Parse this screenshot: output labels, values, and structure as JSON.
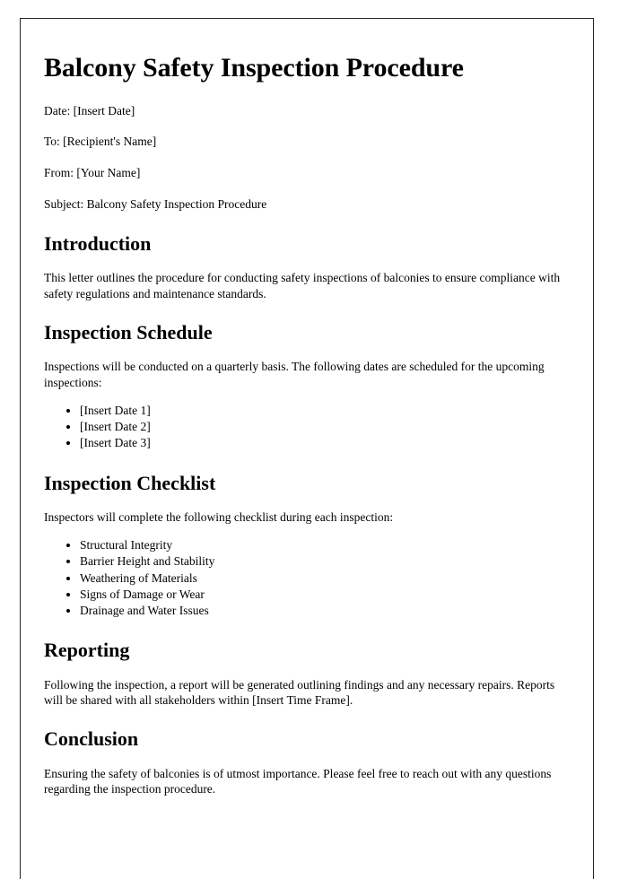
{
  "document": {
    "title": "Balcony Safety Inspection Procedure",
    "meta": [
      {
        "label": "Date:",
        "value": "[Insert Date]",
        "full": "Date: [Insert Date]"
      },
      {
        "label": "To:",
        "value": "[Recipient's Name]",
        "full": "To: [Recipient's Name]"
      },
      {
        "label": "From:",
        "value": "[Your Name]",
        "full": "From: [Your Name]"
      },
      {
        "label": "Subject:",
        "value": "Balcony Safety Inspection Procedure",
        "full": "Subject: Balcony Safety Inspection Procedure"
      }
    ],
    "sections": [
      {
        "heading": "Introduction",
        "paragraph": "This letter outlines the procedure for conducting safety inspections of balconies to ensure compliance with safety regulations and maintenance standards."
      },
      {
        "heading": "Inspection Schedule",
        "paragraph": "Inspections will be conducted on a quarterly basis. The following dates are scheduled for the upcoming inspections:",
        "items": [
          "[Insert Date 1]",
          "[Insert Date 2]",
          "[Insert Date 3]"
        ]
      },
      {
        "heading": "Inspection Checklist",
        "paragraph": "Inspectors will complete the following checklist during each inspection:",
        "items": [
          "Structural Integrity",
          "Barrier Height and Stability",
          "Weathering of Materials",
          "Signs of Damage or Wear",
          "Drainage and Water Issues"
        ]
      },
      {
        "heading": "Reporting",
        "paragraph": "Following the inspection, a report will be generated outlining findings and any necessary repairs. Reports will be shared with all stakeholders within [Insert Time Frame]."
      },
      {
        "heading": "Conclusion",
        "paragraph": "Ensuring the safety of balconies is of utmost importance. Please feel free to reach out with any questions regarding the inspection procedure."
      }
    ]
  },
  "style": {
    "page_border_color": "#262626",
    "page_background": "#ffffff",
    "text_color": "#000000"
  }
}
